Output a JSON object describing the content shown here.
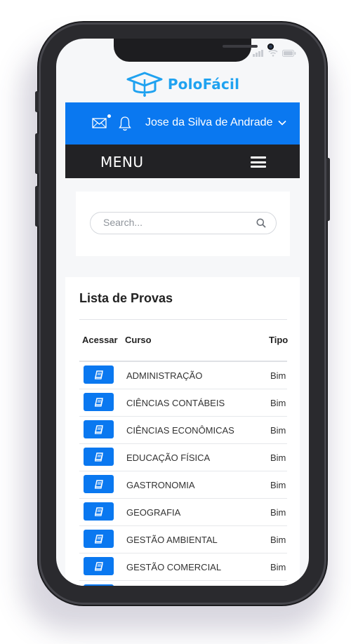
{
  "app": {
    "logo_text": "PoloFácil"
  },
  "header": {
    "user_name": "Jose da Silva de Andrade"
  },
  "menu": {
    "label": "MENU"
  },
  "search": {
    "placeholder": "Search..."
  },
  "list": {
    "title": "Lista de Provas",
    "columns": [
      "Acessar",
      "Curso",
      "Tipo"
    ],
    "rows": [
      {
        "curso": "ADMINISTRAÇÃO",
        "tipo": "Bim"
      },
      {
        "curso": "CIÊNCIAS CONTÁBEIS",
        "tipo": "Bim"
      },
      {
        "curso": "CIÊNCIAS ECONÔMICAS",
        "tipo": "Bim"
      },
      {
        "curso": "EDUCAÇÃO FÍSICA",
        "tipo": "Bim"
      },
      {
        "curso": "GASTRONOMIA",
        "tipo": "Bim"
      },
      {
        "curso": "GEOGRAFIA",
        "tipo": "Bim"
      },
      {
        "curso": "GESTÃO AMBIENTAL",
        "tipo": "Bim"
      },
      {
        "curso": "GESTÃO COMERCIAL",
        "tipo": "Bim"
      }
    ]
  },
  "colors": {
    "primary": "#0a78f0",
    "logo": "#1fa2f0",
    "menu_bg": "#222225"
  },
  "icons": [
    "mail-icon",
    "bell-icon",
    "chevron-down-icon",
    "hamburger-icon",
    "search-icon",
    "book-icon",
    "graduation-cap-icon"
  ]
}
